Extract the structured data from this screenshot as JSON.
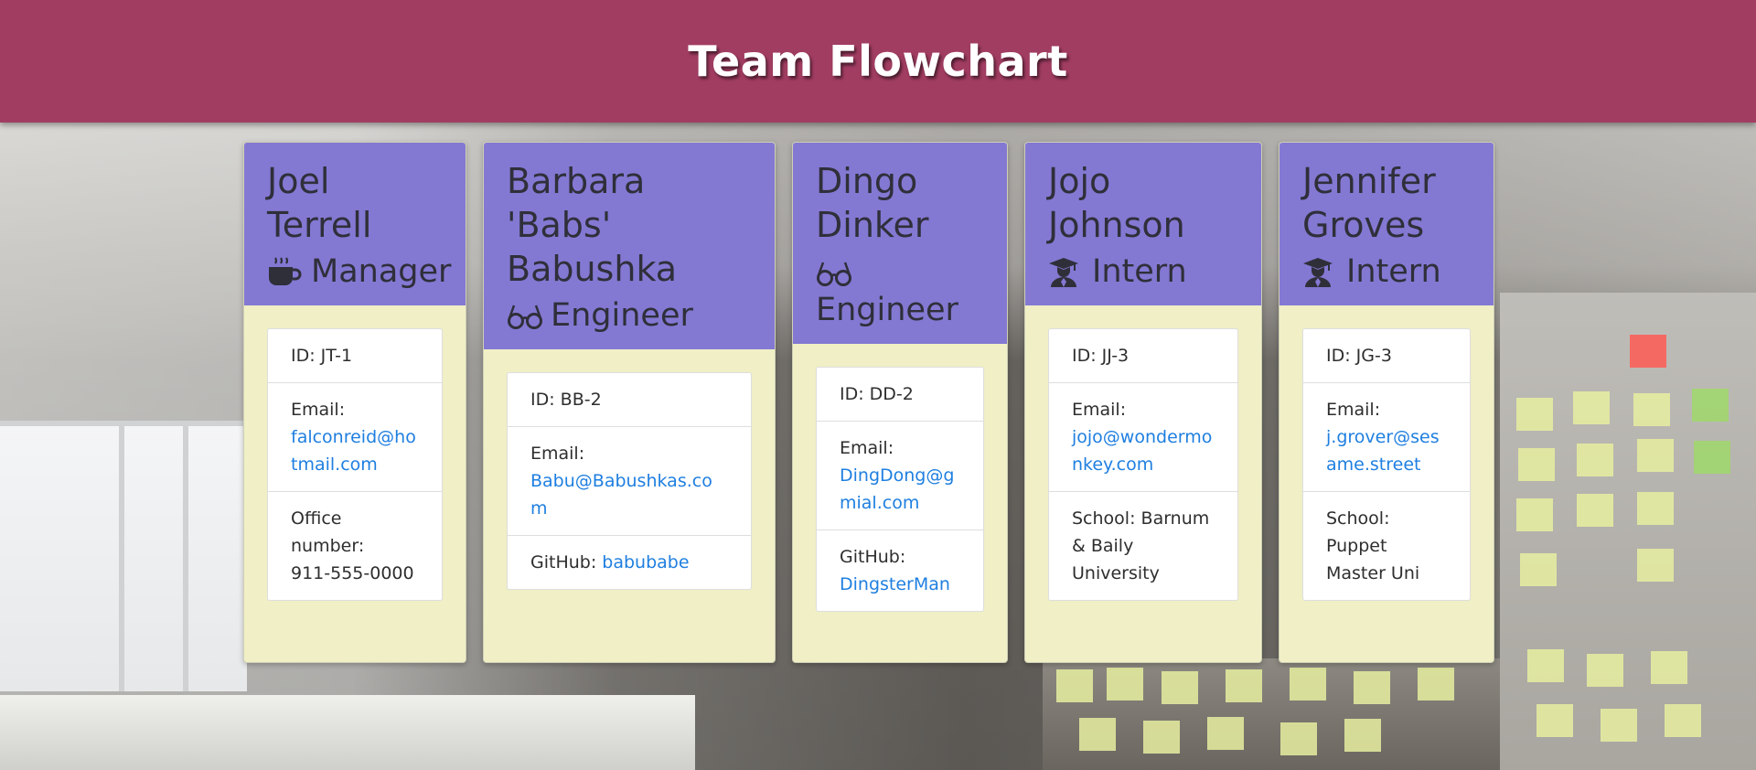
{
  "header": {
    "title": "Team Flowchart"
  },
  "employees": [
    {
      "name": "Joel Terrell",
      "role": "Manager",
      "icon": "coffee-icon",
      "id_label": "ID: JT-1",
      "email_label": "Email:",
      "email": "falconreid@hotmail.com",
      "extra_label": "Office number:",
      "extra_value": "911-555-0000"
    },
    {
      "name": "Barbara 'Babs' Babushka",
      "role": "Engineer",
      "icon": "glasses-icon",
      "id_label": "ID: BB-2",
      "email_label": "Email:",
      "email": "Babu@Babushkas.com",
      "extra_label": "GitHub:",
      "extra_value": "babubabe"
    },
    {
      "name": "Dingo Dinker",
      "role": "Engineer",
      "icon": "glasses-icon",
      "id_label": "ID: DD-2",
      "email_label": "Email:",
      "email": "DingDong@gmial.com",
      "extra_label": "GitHub:",
      "extra_value": "DingsterMan"
    },
    {
      "name": "Jojo Johnson",
      "role": "Intern",
      "icon": "graduate-icon",
      "id_label": "ID: JJ-3",
      "email_label": "Email:",
      "email": "jojo@wondermonkey.com",
      "extra_label": "School:",
      "extra_value": "Barnum & Baily University"
    },
    {
      "name": "Jennifer Groves",
      "role": "Intern",
      "icon": "graduate-icon",
      "id_label": "ID: JG-3",
      "email_label": "Email:",
      "email": "j.grover@sesame.street",
      "extra_label": "School:",
      "extra_value": "Puppet Master Uni"
    }
  ],
  "colors": {
    "header": "#a23d62",
    "card_head": "#8379d3",
    "card_body": "#f0efc6",
    "link": "#1f7fe0"
  }
}
